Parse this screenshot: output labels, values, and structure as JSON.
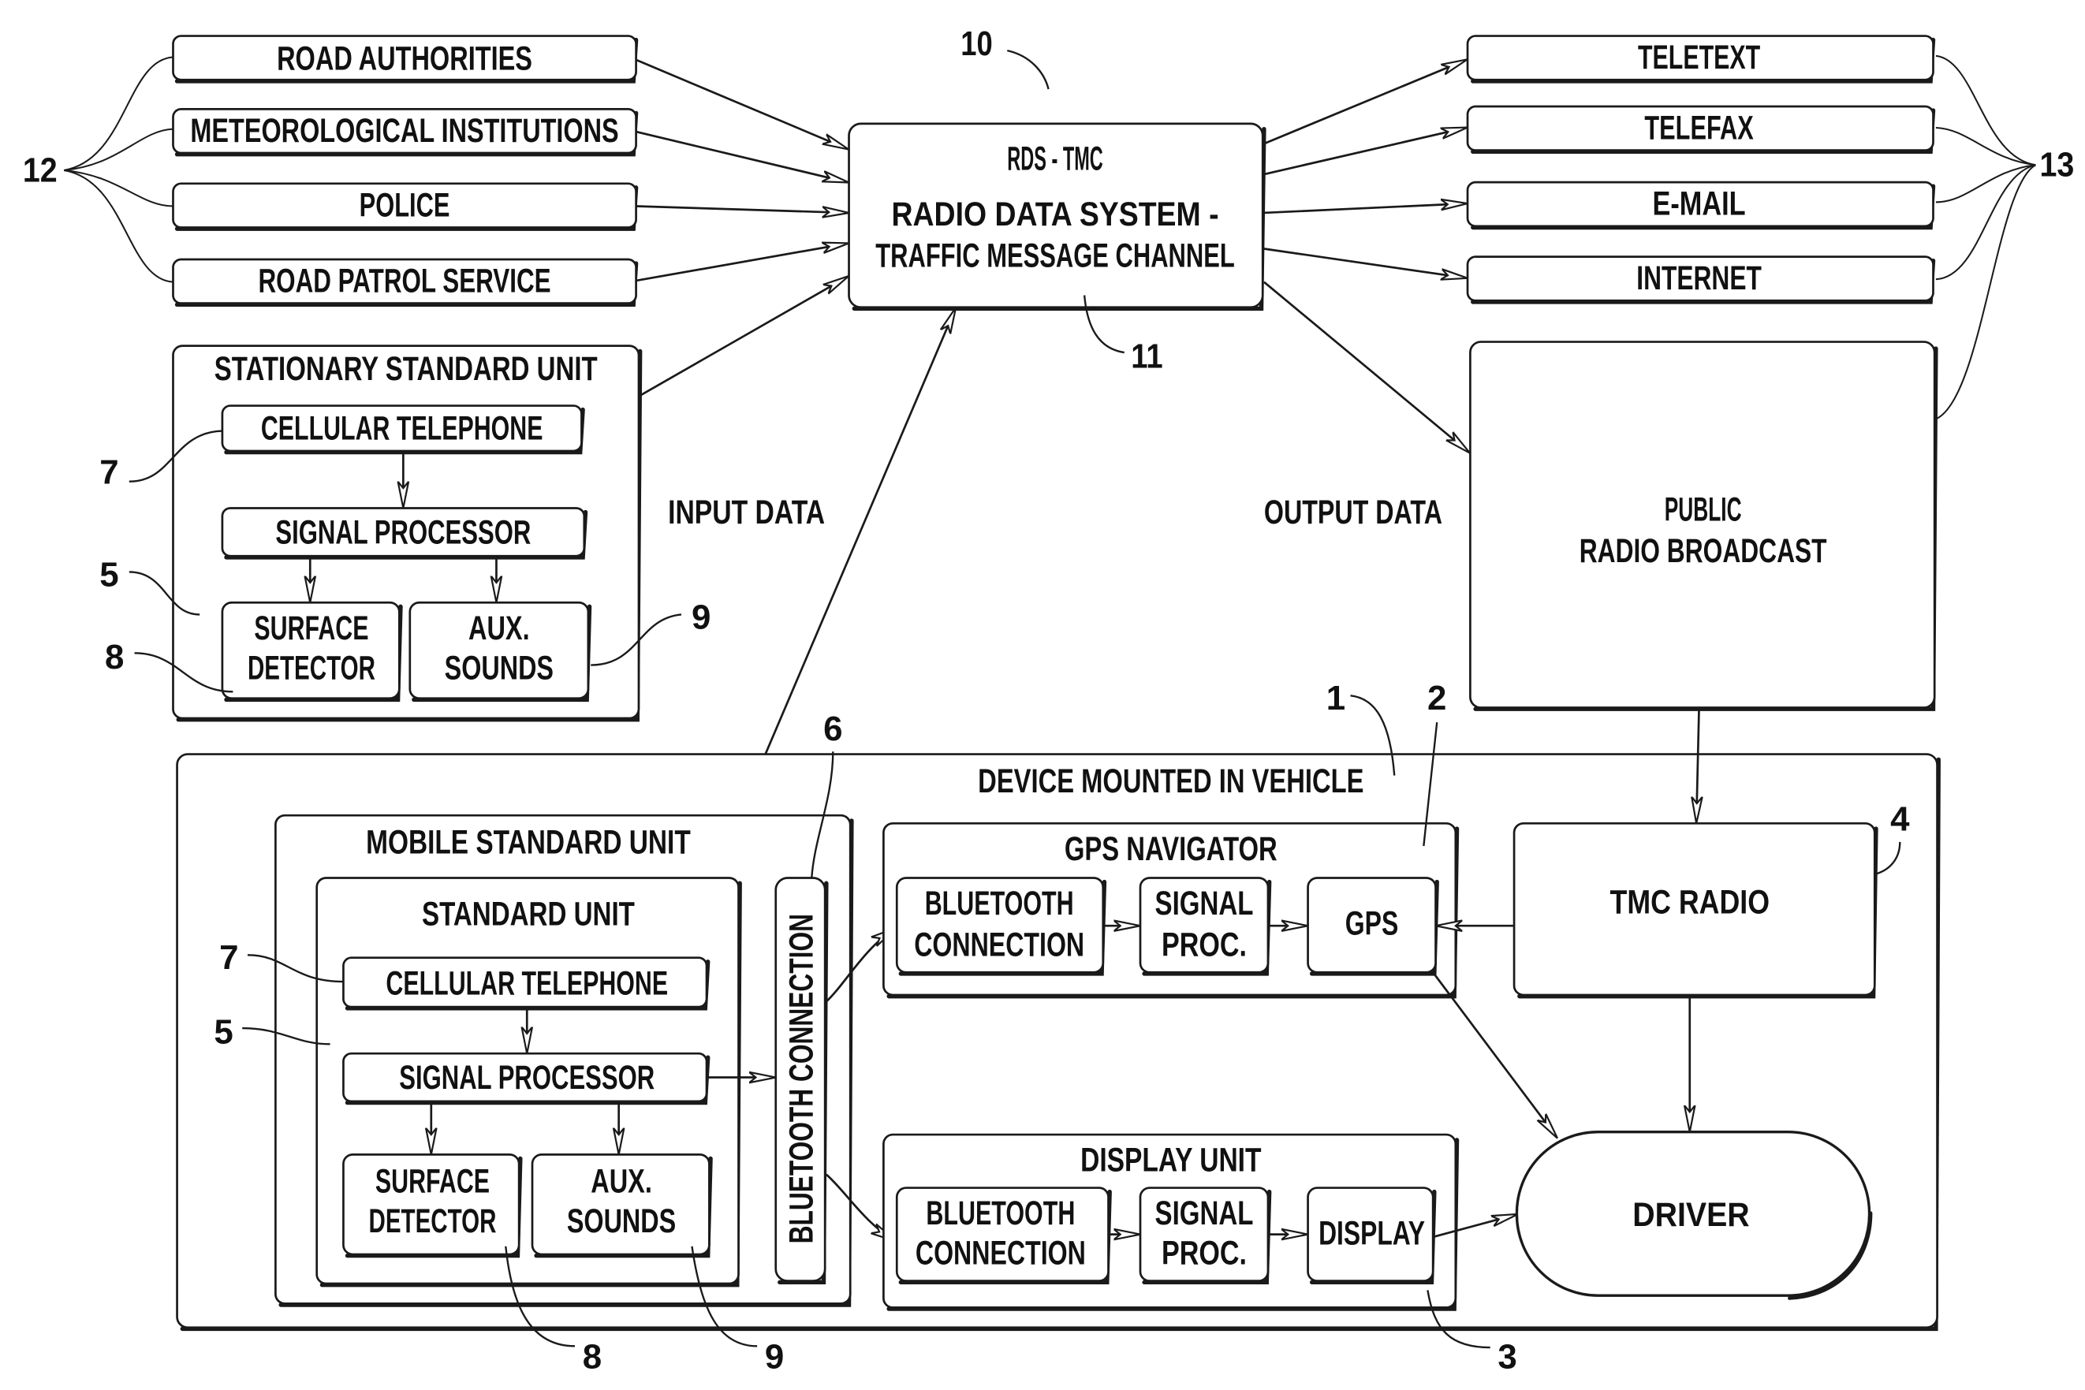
{
  "figure": {
    "system_ref": "10",
    "center": {
      "ref": "11",
      "title": "RDS - TMC",
      "subtitle_line1": "RADIO DATA SYSTEM -",
      "subtitle_line2": "TRAFFIC MESSAGE CHANNEL"
    },
    "inputs": {
      "ref": "12",
      "caption": "INPUT DATA",
      "sources": [
        {
          "label": "ROAD AUTHORITIES"
        },
        {
          "label": "METEOROLOGICAL INSTITUTIONS"
        },
        {
          "label": "POLICE"
        },
        {
          "label": "ROAD PATROL SERVICE"
        }
      ]
    },
    "outputs": {
      "ref": "13",
      "caption": "OUTPUT DATA",
      "channels": [
        {
          "label": "TELETEXT"
        },
        {
          "label": "TELEFAX"
        },
        {
          "label": "E-MAIL"
        },
        {
          "label": "INTERNET"
        }
      ],
      "broadcast_line1": "PUBLIC",
      "broadcast_line2": "RADIO BROADCAST"
    },
    "stationary_unit": {
      "title": "STATIONARY STANDARD UNIT",
      "cellular": "CELLULAR TELEPHONE",
      "processor": "SIGNAL PROCESSOR",
      "surface_line1": "SURFACE",
      "surface_line2": "DETECTOR",
      "aux_line1": "AUX.",
      "aux_line2": "SOUNDS",
      "ref_cellular": "7",
      "ref_unit": "5",
      "ref_surface": "8",
      "ref_aux": "9"
    },
    "vehicle": {
      "ref": "1",
      "title": "DEVICE MOUNTED IN VEHICLE",
      "mobile_unit": {
        "title": "MOBILE STANDARD UNIT",
        "standard_unit_title": "STANDARD UNIT",
        "cellular": "CELLULAR TELEPHONE",
        "processor": "SIGNAL PROCESSOR",
        "surface_line1": "SURFACE",
        "surface_line2": "DETECTOR",
        "aux_line1": "AUX.",
        "aux_line2": "SOUNDS",
        "bluetooth": "BLUETOOTH CONNECTION",
        "ref_cellular": "7",
        "ref_unit": "5",
        "ref_surface": "8",
        "ref_aux": "9",
        "ref_bluetooth": "6"
      },
      "gps_navigator": {
        "ref": "2",
        "title": "GPS NAVIGATOR",
        "bt_line1": "BLUETOOTH",
        "bt_line2": "CONNECTION",
        "sig_line1": "SIGNAL",
        "sig_line2": "PROC.",
        "gps": "GPS"
      },
      "display_unit": {
        "ref": "3",
        "title": "DISPLAY UNIT",
        "bt_line1": "BLUETOOTH",
        "bt_line2": "CONNECTION",
        "sig_line1": "SIGNAL",
        "sig_line2": "PROC.",
        "display": "DISPLAY"
      },
      "tmc_radio": {
        "ref": "4",
        "label": "TMC RADIO"
      },
      "driver": {
        "label": "DRIVER"
      }
    }
  }
}
